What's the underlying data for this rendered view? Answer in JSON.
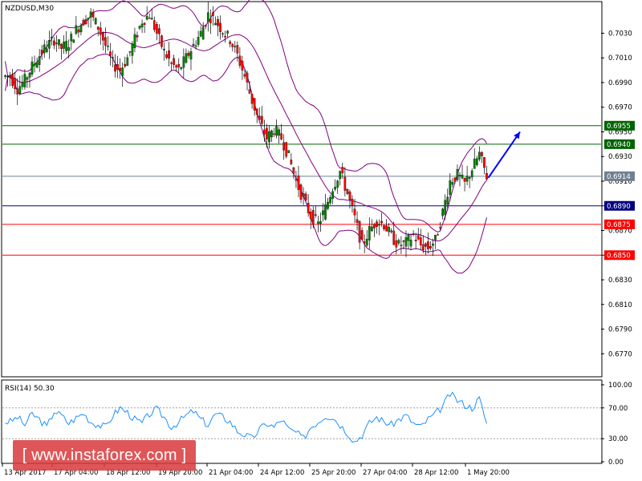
{
  "chart_data": [
    {
      "type": "candlestick",
      "title": "NZDUSD,M30",
      "symbol": "NZDUSD",
      "timeframe": "M30",
      "ylim": [
        0.6752,
        0.7055
      ],
      "y_ticks": [
        0.703,
        0.701,
        0.699,
        0.697,
        0.695,
        0.693,
        0.691,
        0.689,
        0.687,
        0.685,
        0.683,
        0.681,
        0.679,
        0.677
      ],
      "x_tick_labels": [
        "13 Apr 2017",
        "17 Apr 04:00",
        "18 Apr 12:00",
        "19 Apr 20:00",
        "21 Apr 04:00",
        "24 Apr 12:00",
        "25 Apr 20:00",
        "27 Apr 04:00",
        "28 Apr 12:00",
        "1 May 20:00"
      ],
      "indicators": [
        "Bollinger Bands"
      ],
      "series": [
        {
          "name": "Close",
          "values": [
            0.6995,
            0.6985,
            0.6992,
            0.7003,
            0.7012,
            0.702,
            0.7025,
            0.7018,
            0.7022,
            0.7033,
            0.704,
            0.7045,
            0.7035,
            0.702,
            0.7005,
            0.7,
            0.701,
            0.7025,
            0.704,
            0.7045,
            0.703,
            0.7015,
            0.7005,
            0.7,
            0.701,
            0.702,
            0.703,
            0.7045,
            0.704,
            0.7032,
            0.7025,
            0.7012,
            0.6995,
            0.6975,
            0.6958,
            0.6945,
            0.6952,
            0.6945,
            0.693,
            0.691,
            0.6895,
            0.6882,
            0.6875,
            0.6888,
            0.6905,
            0.6918,
            0.69,
            0.688,
            0.6858,
            0.687,
            0.6878,
            0.6875,
            0.6865,
            0.6858,
            0.686,
            0.6866,
            0.6858,
            0.6856,
            0.6862,
            0.6885,
            0.691,
            0.6915,
            0.6908,
            0.692,
            0.6932,
            0.6914
          ]
        }
      ],
      "horizontal_levels": [
        {
          "value": 0.6955,
          "label": "0.6955",
          "color": "#006400"
        },
        {
          "value": 0.694,
          "label": "0.6940",
          "color": "#006400"
        },
        {
          "value": 0.6914,
          "label": "0.6914",
          "color": "#708090",
          "note": "current price"
        },
        {
          "value": 0.689,
          "label": "0.6890",
          "color": "#000080"
        },
        {
          "value": 0.6875,
          "label": "0.6875",
          "color": "#ff0000"
        },
        {
          "value": 0.685,
          "label": "0.6850",
          "color": "#ff0000"
        }
      ],
      "arrow": {
        "direction": "up",
        "color": "#0000ff"
      },
      "colors": {
        "bull": "#008000",
        "bear": "#ff0000",
        "bands": "#800080",
        "axis_text": "#000000"
      }
    },
    {
      "type": "line",
      "title": "RSI(14) 50.30",
      "name": "RSI(14)",
      "current": 50.3,
      "ylim": [
        0,
        100
      ],
      "y_ticks": [
        "100.00",
        "70.00",
        "30.00",
        "0.00"
      ],
      "levels": [
        70,
        30
      ],
      "series": [
        {
          "name": "RSI",
          "values": [
            52,
            58,
            48,
            62,
            55,
            45,
            66,
            60,
            50,
            57,
            63,
            52,
            48,
            45,
            60,
            70,
            64,
            55,
            50,
            62,
            68,
            58,
            45,
            52,
            60,
            66,
            55,
            48,
            62,
            58,
            52,
            40,
            35,
            30,
            42,
            50,
            45,
            55,
            42,
            38,
            30,
            45,
            52,
            60,
            58,
            48,
            38,
            26,
            35,
            50,
            58,
            52,
            48,
            55,
            60,
            50,
            45,
            55,
            62,
            72,
            88,
            80,
            74,
            70,
            82,
            50
          ]
        }
      ],
      "colors": {
        "line": "#1e90ff"
      }
    }
  ],
  "watermark": {
    "text": "[ www.instaforex.com ]"
  }
}
